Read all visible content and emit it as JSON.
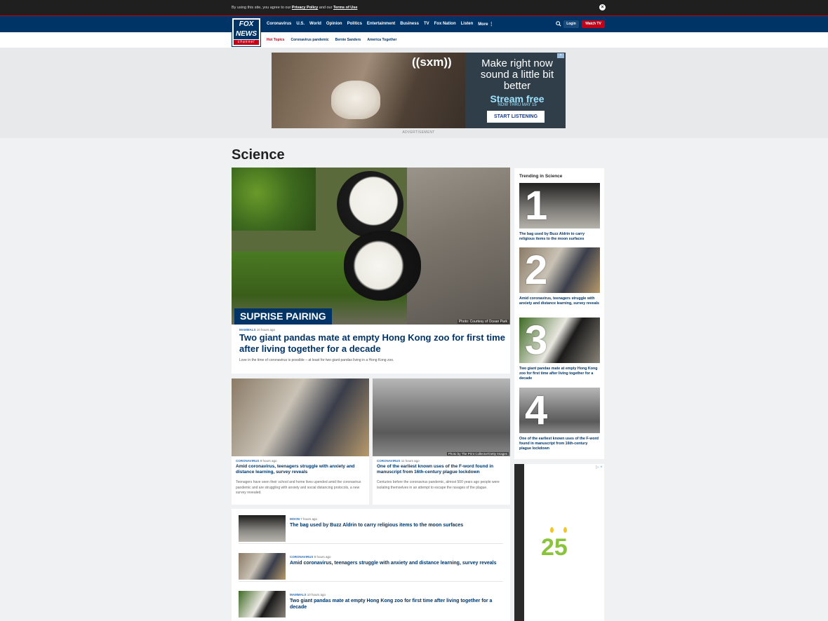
{
  "cookie": {
    "prefix": "By using this site, you agree to our",
    "privacy": "Privacy Policy",
    "and": "and our",
    "terms": "Terms of Use",
    "close": "×"
  },
  "logo": {
    "line1": "FOX",
    "line2": "NEWS",
    "line3": "channel"
  },
  "nav": [
    "Coronavirus",
    "U.S.",
    "World",
    "Opinion",
    "Politics",
    "Entertainment",
    "Business",
    "TV",
    "Fox Nation",
    "Listen",
    "More ⋮"
  ],
  "header": {
    "search_icon": "search-icon",
    "login": "Login",
    "watch": "Watch TV"
  },
  "hot_topics": {
    "label": "Hot Topics",
    "items": [
      "Coronavirus pandemic",
      "Bernie Sanders",
      "America Together"
    ]
  },
  "ad": {
    "brand": "((sxm))",
    "headline": "Make right now sound a little bit better",
    "stream": "Stream free",
    "until": "NOW THRU MAY 15",
    "cta": "START LISTENING",
    "label": "ADVERTISEMENT"
  },
  "section": {
    "title": "Science"
  },
  "hero": {
    "kicker": "SUPRISE PAIRING",
    "credit": "Photo: Courtesy of Ocean Park",
    "category": "MAMMALS",
    "time": "10 hours ago",
    "title": "Two giant pandas mate at empty Hong Kong zoo for first time after living together for a decade",
    "dek": "Love in the time of coronavirus is possible – at least for two giant pandas living in a Hong Kong zoo."
  },
  "cards": [
    {
      "category": "CORONAVIRUS",
      "time": "9 hours ago",
      "title": "Amid coronavirus, teenagers struggle with anxiety and distance learning, survey reveals",
      "dek": "Teenagers have seen their school and home lives upended amid the coronavirus pandemic and are struggling with anxiety and social distancing protocols, a new survey revealed."
    },
    {
      "category": "CORONAVIRUS",
      "time": "11 hours ago",
      "title": "One of the earliest known uses of the F-word found in manuscript from 16th-century plague lockdown",
      "dek": "Centuries before the coronavirus pandemic, almost 500 years ago people were isolating themselves in an attempt to escape the ravages of the plague.",
      "credit": "Photo by The Print Collector/Getty Images"
    }
  ],
  "list": [
    {
      "category": "MOON",
      "time": "7 hours ago",
      "title": "The bag used by Buzz Aldrin to carry religious items to the moon surfaces"
    },
    {
      "category": "CORONAVIRUS",
      "time": "9 hours ago",
      "title": "Amid coronavirus, teenagers struggle with anxiety and distance learning, survey reveals"
    },
    {
      "category": "MAMMALS",
      "time": "10 hours ago",
      "title": "Two giant pandas mate at empty Hong Kong zoo for first time after living together for a decade"
    }
  ],
  "trending": {
    "heading": "Trending in Science",
    "items": [
      {
        "num": "1",
        "title": "The bag used by Buzz Aldrin to carry religious items to the moon surfaces"
      },
      {
        "num": "2",
        "title": "Amid coronavirus, teenagers struggle with anxiety and distance learning, survey reveals"
      },
      {
        "num": "3",
        "title": "Two giant pandas mate at empty Hong Kong zoo for first time after living together for a decade"
      },
      {
        "num": "4",
        "title": "One of the earliest known uses of the F-word found in manuscript from 16th-century plague lockdown"
      }
    ]
  },
  "side_ad": {
    "number": "25",
    "adchoices": "▷ ×"
  }
}
